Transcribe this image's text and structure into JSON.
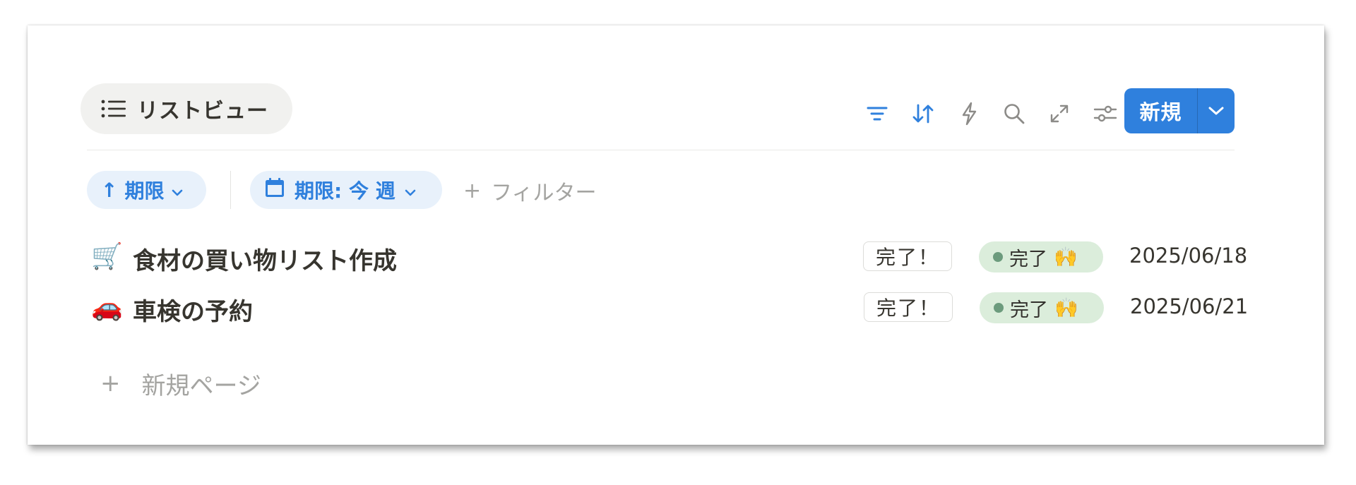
{
  "view": {
    "tab_label": "リストビュー",
    "tab_icon": "list-icon"
  },
  "toolbar": {
    "icons": [
      "filter-icon",
      "sort-icon",
      "lightning-icon",
      "search-icon",
      "expand-icon",
      "settings-icon"
    ],
    "new_label": "新規",
    "accent": "#2f80dd"
  },
  "filters": {
    "sort_chip": {
      "arrow": "↑",
      "label": "期限"
    },
    "date_chip": {
      "label": "期限: 今 週"
    },
    "add_filter": {
      "plus": "+",
      "label": "フィルター"
    }
  },
  "rows": [
    {
      "emoji": "🛒",
      "title": "食材の買い物リスト作成",
      "tag": "完了！",
      "status": "完了",
      "status_emoji": "🙌",
      "date": "2025/06/18"
    },
    {
      "emoji": "🚗",
      "title": "車検の予約",
      "tag": "完了！",
      "status": "完了",
      "status_emoji": "🙌",
      "date": "2025/06/21"
    }
  ],
  "new_page": {
    "plus": "+",
    "label": "新規ページ"
  }
}
